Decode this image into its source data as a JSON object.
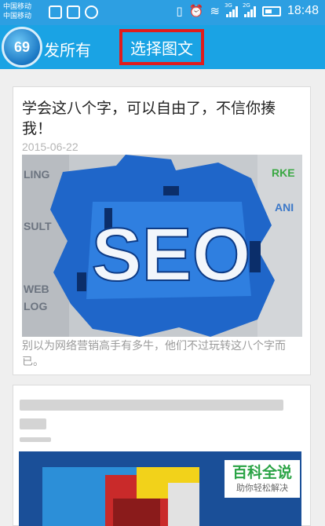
{
  "status_bar": {
    "carrier_1": "中国移动",
    "carrier_2": "中国移动",
    "network_1": "3G",
    "network_2": "2G",
    "time": "18:48"
  },
  "title_bar": {
    "badge_count": "69",
    "title": "发所有",
    "mode_button": "选择图文"
  },
  "articles": [
    {
      "title": "学会这八个字，可以自由了，不信你揍我！",
      "date": "2015-06-22",
      "image_text": "SEO",
      "image_side_words": [
        "LING",
        "SULT",
        "WEB",
        "LOG",
        "RKE",
        "ANI"
      ],
      "summary": "别以为网络营销高手有多牛，他们不过玩转这八个字而已。"
    }
  ],
  "watermark": {
    "title": "百科全说",
    "subtitle": "助你轻松解决"
  },
  "colors": {
    "status_bar": "#2d9fe2",
    "title_bar": "#1aa3e4",
    "highlight_border": "#e01c1c",
    "watermark_green": "#2aa345"
  }
}
